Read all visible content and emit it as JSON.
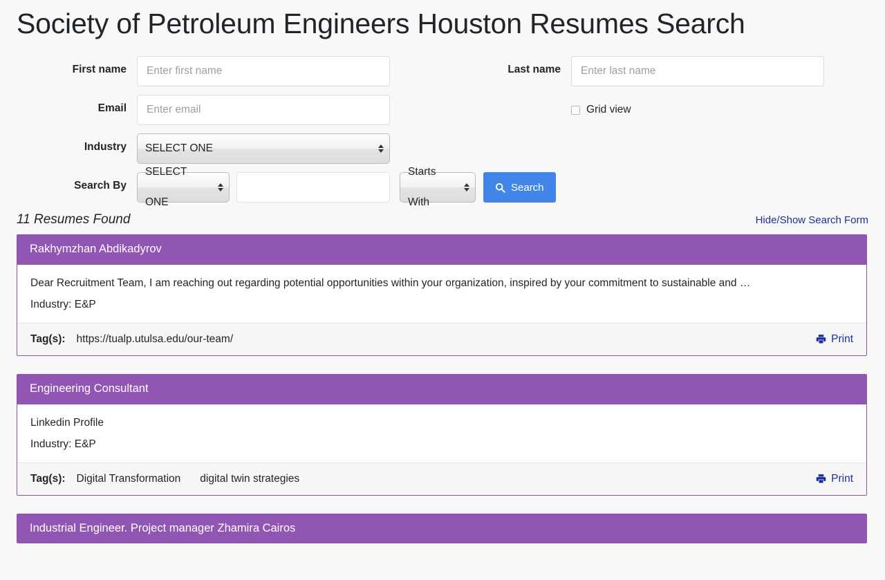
{
  "page": {
    "title": "Society of Petroleum Engineers Houston Resumes Search"
  },
  "form": {
    "first_name": {
      "label": "First name",
      "placeholder": "Enter first name",
      "value": ""
    },
    "last_name": {
      "label": "Last name",
      "placeholder": "Enter last name",
      "value": ""
    },
    "email": {
      "label": "Email",
      "placeholder": "Enter email",
      "value": ""
    },
    "grid_view": {
      "label": "Grid view",
      "checked": false
    },
    "industry": {
      "label": "Industry",
      "selected": "SELECT ONE"
    },
    "search_by": {
      "label": "Search By",
      "field_selected": "SELECT ONE",
      "term_value": "",
      "term_placeholder": "",
      "mode_selected": "Starts With"
    },
    "search_button": {
      "label": "Search",
      "icon": "search-icon",
      "color": "#4285e8"
    }
  },
  "results": {
    "count_text": "11 Resumes Found",
    "toggle_form_link": "Hide/Show Search Form",
    "tags_label": "Tag(s):",
    "print_label": "Print",
    "header_color": "#9155b3",
    "cards": [
      {
        "title": "Rakhymzhan Abdikadyrov",
        "description": "Dear Recruitment Team, I am reaching out regarding potential opportunities within your organization, inspired by your commitment to sustainable and …",
        "industry": "Industry: E&P",
        "tags": [
          "https://tualp.utulsa.edu/our-team/"
        ]
      },
      {
        "title": "Engineering Consultant",
        "description": "Linkedin Profile",
        "industry": "Industry: E&P",
        "tags": [
          "Digital Transformation",
          "digital twin strategies"
        ]
      },
      {
        "title": "Industrial Engineer. Project manager Zhamira Cairos",
        "description": "",
        "industry": "",
        "tags": []
      }
    ]
  }
}
